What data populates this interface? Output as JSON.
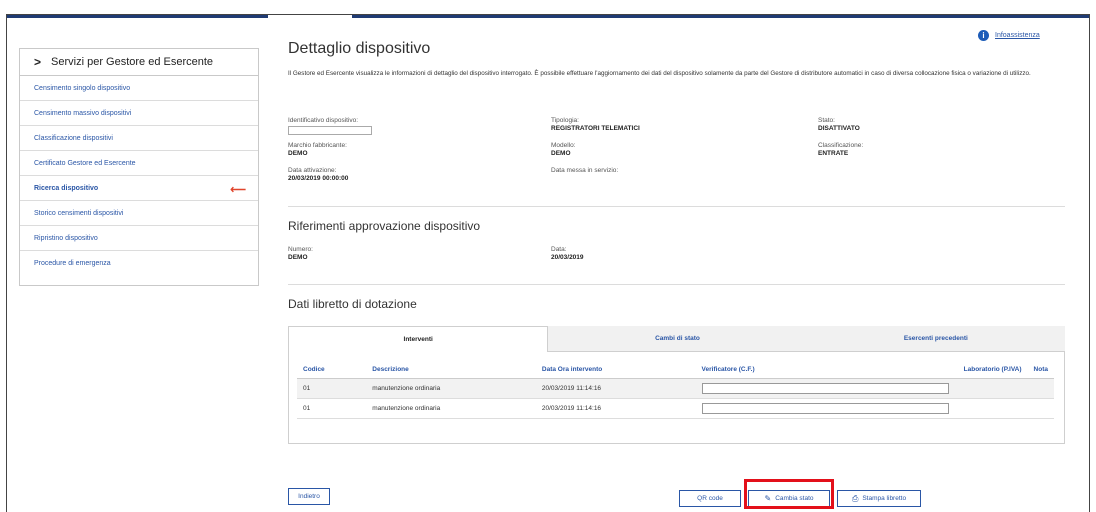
{
  "sidebar": {
    "title": "Servizi per Gestore ed Esercente",
    "items": [
      {
        "label": "Censimento singolo dispositivo"
      },
      {
        "label": "Censimento massivo dispositivi"
      },
      {
        "label": "Classificazione dispositivi"
      },
      {
        "label": "Certificato Gestore ed Esercente"
      },
      {
        "label": "Ricerca dispositivo",
        "active": true
      },
      {
        "label": "Storico censimenti dispositivi"
      },
      {
        "label": "Ripristino dispositivo"
      },
      {
        "label": "Procedure di emergenza"
      }
    ]
  },
  "help": {
    "label": "Infoassistenza"
  },
  "page": {
    "title": "Dettaglio dispositivo",
    "intro": "Il Gestore ed Esercente visualizza le informazioni di dettaglio del dispositivo interrogato. È possibile effettuare l'aggiornamento dei dati del dispositivo solamente da parte del Gestore di distributore automatici in caso di diversa collocazione fisica o variazione di utilizzo."
  },
  "device": {
    "identificativo_label": "Identificativo dispositivo:",
    "tipologia_label": "Tipologia:",
    "tipologia": "REGISTRATORI TELEMATICI",
    "stato_label": "Stato:",
    "stato": "DISATTIVATO",
    "marchio_label": "Marchio fabbricante:",
    "marchio": "DEMO",
    "modello_label": "Modello:",
    "modello": "DEMO",
    "classificazione_label": "Classificazione:",
    "classificazione": "ENTRATE",
    "attivazione_label": "Data attivazione:",
    "attivazione": "20/03/2019 00:00:00",
    "messa_label": "Data messa in servizio:"
  },
  "approvazione": {
    "title": "Riferimenti approvazione dispositivo",
    "numero_label": "Numero:",
    "numero": "DEMO",
    "data_label": "Data:",
    "data": "20/03/2019"
  },
  "libretto": {
    "title": "Dati libretto di dotazione",
    "tabs": [
      {
        "label": "Interventi"
      },
      {
        "label": "Cambi di stato"
      },
      {
        "label": "Esercenti precedenti"
      }
    ],
    "columns": [
      "Codice",
      "Descrizione",
      "Data Ora intervento",
      "Verificatore (C.F.)",
      "Laboratorio (P.IVA)",
      "Nota"
    ],
    "rows": [
      {
        "codice": "01",
        "descrizione": "manutenzione ordinaria",
        "data": "20/03/2019 11:14:16"
      },
      {
        "codice": "01",
        "descrizione": "manutenzione ordinaria",
        "data": "20/03/2019 11:14:16"
      }
    ]
  },
  "buttons": {
    "back": "Indietro",
    "qr": "QR code",
    "change_state": "Cambia stato",
    "print": "Stampa libretto"
  },
  "colors": {
    "link": "#2a56a6",
    "topbar": "#1f3b73",
    "highlight": "#e3101a"
  }
}
